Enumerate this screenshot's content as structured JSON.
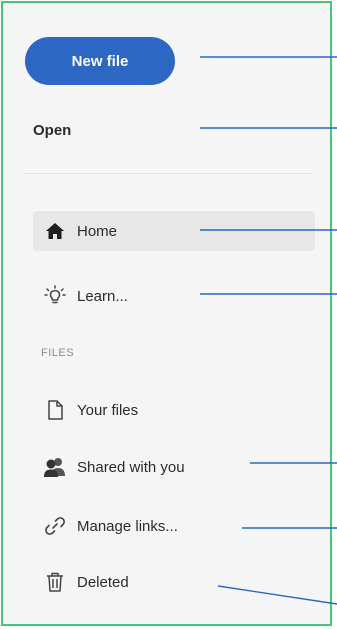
{
  "sidebar": {
    "new_file_label": "New file",
    "open_label": "Open",
    "items": [
      {
        "label": "Home",
        "icon": "home-icon",
        "active": true
      },
      {
        "label": "Learn...",
        "icon": "lightbulb-icon",
        "active": false
      }
    ],
    "section_label": "FILES",
    "file_items": [
      {
        "label": "Your files",
        "icon": "document-icon"
      },
      {
        "label": "Shared with you",
        "icon": "users-icon"
      },
      {
        "label": "Manage links...",
        "icon": "link-icon"
      },
      {
        "label": "Deleted",
        "icon": "trash-icon"
      }
    ]
  },
  "colors": {
    "accent": "#2c67c4",
    "frame_border": "#4cc27d",
    "callout_line": "#2c67c4",
    "active_bg": "#e7e7e7",
    "panel_bg": "#f5f5f5"
  }
}
